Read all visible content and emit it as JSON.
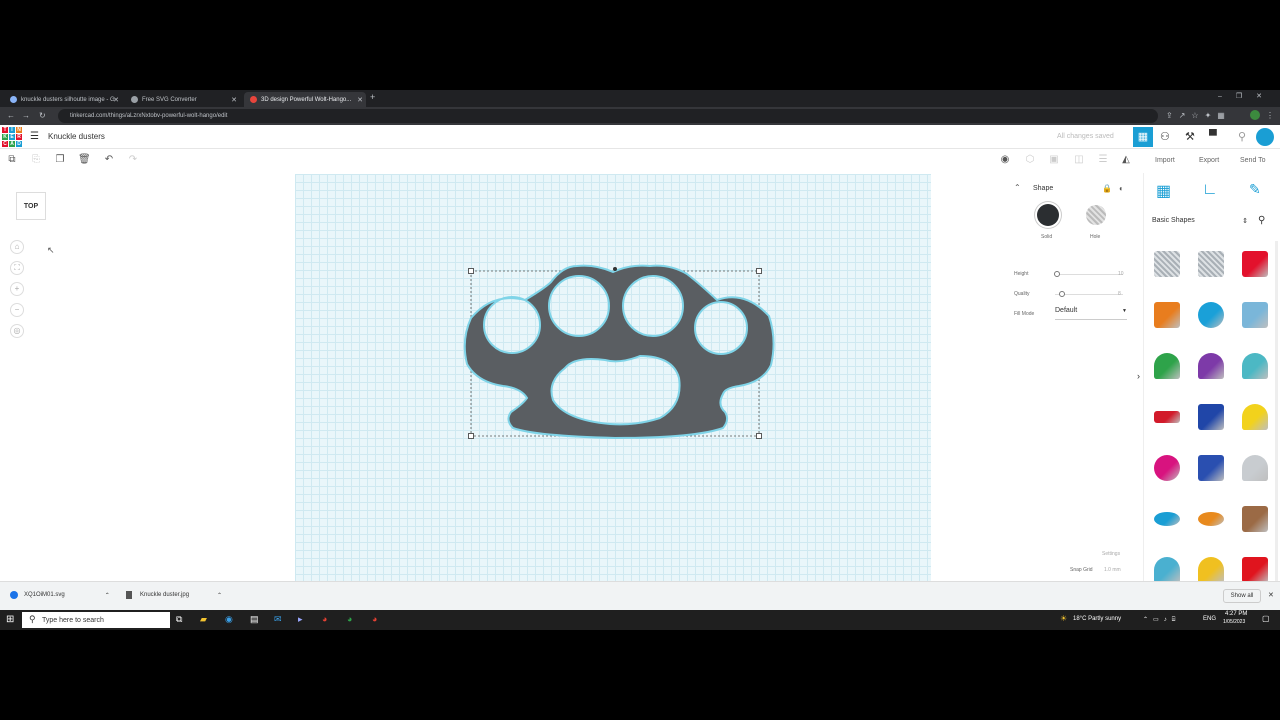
{
  "browser": {
    "tabs": [
      {
        "label": "knuckle dusters silhoutte image - G"
      },
      {
        "label": "Free SVG Converter"
      },
      {
        "label": "3D design Powerful Wolt-Hango..."
      }
    ],
    "url": "tinkercad.com/things/aLzrxNxtobv-powerful-wolt-hango/edit"
  },
  "app": {
    "logo_letters": [
      "T",
      "I",
      "N",
      "K",
      "E",
      "R",
      "C",
      "A",
      "D"
    ],
    "title": "Knuckle dusters",
    "save_status": "All changes saved",
    "actions": {
      "import": "Import",
      "export": "Export",
      "send_to": "Send To"
    },
    "view_cube": "TOP"
  },
  "shape_panel": {
    "title": "Shape",
    "solid_label": "Solid",
    "hole_label": "Hole",
    "height_label": "Height",
    "height_value": "10",
    "quality_label": "Quality",
    "quality_value": "8",
    "fill_mode_label": "Fill Mode",
    "fill_mode_value": "Default"
  },
  "library": {
    "category": "Basic Shapes",
    "shapes": [
      {
        "name": "box-striped",
        "color": "#bfc6cc"
      },
      {
        "name": "cylinder-striped",
        "color": "#bfc6cc"
      },
      {
        "name": "box",
        "color": "#e3112c"
      },
      {
        "name": "cylinder",
        "color": "#e87d1e"
      },
      {
        "name": "sphere",
        "color": "#1aa0d8"
      },
      {
        "name": "scribble",
        "color": "#7ab6d9"
      },
      {
        "name": "roof",
        "color": "#2ea34a"
      },
      {
        "name": "cone",
        "color": "#7d3aa8"
      },
      {
        "name": "round-roof",
        "color": "#4cb8c4"
      },
      {
        "name": "text",
        "color": "#d21a2a"
      },
      {
        "name": "polygon",
        "color": "#2046a8"
      },
      {
        "name": "pyramid",
        "color": "#f2d21c"
      },
      {
        "name": "half-sphere",
        "color": "#d8137f"
      },
      {
        "name": "hexagonal-prism",
        "color": "#2a4fb0"
      },
      {
        "name": "paraboloid",
        "color": "#c8ccd0"
      },
      {
        "name": "torus",
        "color": "#1a9ed4"
      },
      {
        "name": "tube",
        "color": "#e88a1e"
      },
      {
        "name": "wedge",
        "color": "#9b6a45"
      },
      {
        "name": "star",
        "color": "#4ab0d0"
      },
      {
        "name": "star-gold",
        "color": "#f0c020"
      },
      {
        "name": "icosahedron",
        "color": "#e0141e"
      }
    ]
  },
  "footer": {
    "settings_label": "Settings",
    "snap_grid_label": "Snap Grid",
    "snap_grid_value": "1.0 mm"
  },
  "downloads": {
    "items": [
      {
        "name": "XQ1OiM01.svg"
      },
      {
        "name": "Knuckle duster.jpg"
      }
    ],
    "show_all": "Show all"
  },
  "taskbar": {
    "search_placeholder": "Type here to search",
    "weather": "18°C  Partly sunny",
    "lang": "ENG",
    "time": "4:27 PM",
    "date": "1/05/2023"
  }
}
